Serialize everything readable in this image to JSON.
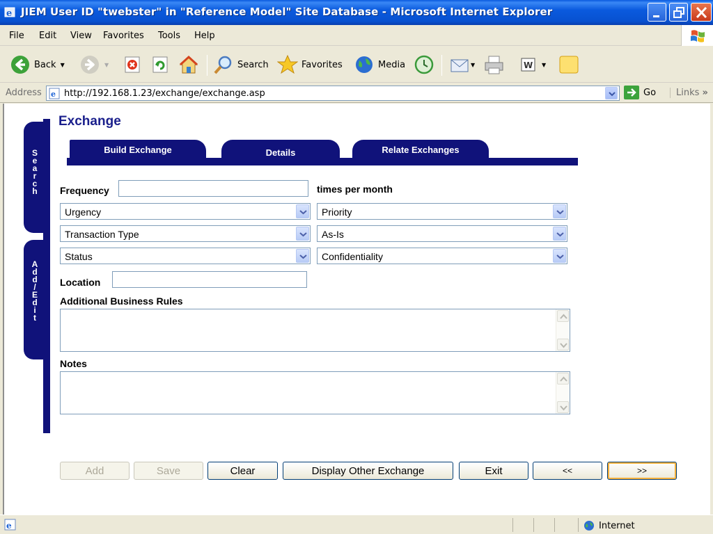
{
  "window": {
    "title": "JIEM User ID \"twebster\" in \"Reference Model\" Site Database - Microsoft Internet Explorer"
  },
  "menu": [
    "File",
    "Edit",
    "View",
    "Favorites",
    "Tools",
    "Help"
  ],
  "toolbar": {
    "back": "Back",
    "search": "Search",
    "favorites": "Favorites",
    "media": "Media"
  },
  "address": {
    "label": "Address",
    "url": "http://192.168.1.23/exchange/exchange.asp",
    "go": "Go",
    "links": "Links"
  },
  "side_tabs": {
    "search": [
      "S",
      "e",
      "a",
      "r",
      "c",
      "h"
    ],
    "add_edit": [
      "A",
      "d",
      "d",
      "/",
      "E",
      "d",
      "i",
      "t"
    ]
  },
  "page": {
    "heading": "Exchange",
    "tabs": [
      "Build Exchange",
      "Details",
      "Relate Exchanges"
    ],
    "active_tab": "Details"
  },
  "form": {
    "frequency_label": "Frequency",
    "frequency_value": "",
    "times_per_month": "times per month",
    "urgency": "Urgency",
    "priority": "Priority",
    "transaction_type": "Transaction Type",
    "as_is": "As-Is",
    "status": "Status",
    "confidentiality": "Confidentiality",
    "location_label": "Location",
    "location_value": "",
    "business_rules_label": "Additional Business Rules",
    "notes_label": "Notes"
  },
  "buttons": {
    "add": "Add",
    "save": "Save",
    "clear": "Clear",
    "display_other": "Display Other Exchange",
    "exit": "Exit",
    "prev": "<<",
    "next": ">>"
  },
  "status": {
    "zone": "Internet"
  },
  "colors": {
    "navy": "#10127a",
    "heading": "#1a1f8c",
    "xp_blue": "#0a5ade"
  }
}
